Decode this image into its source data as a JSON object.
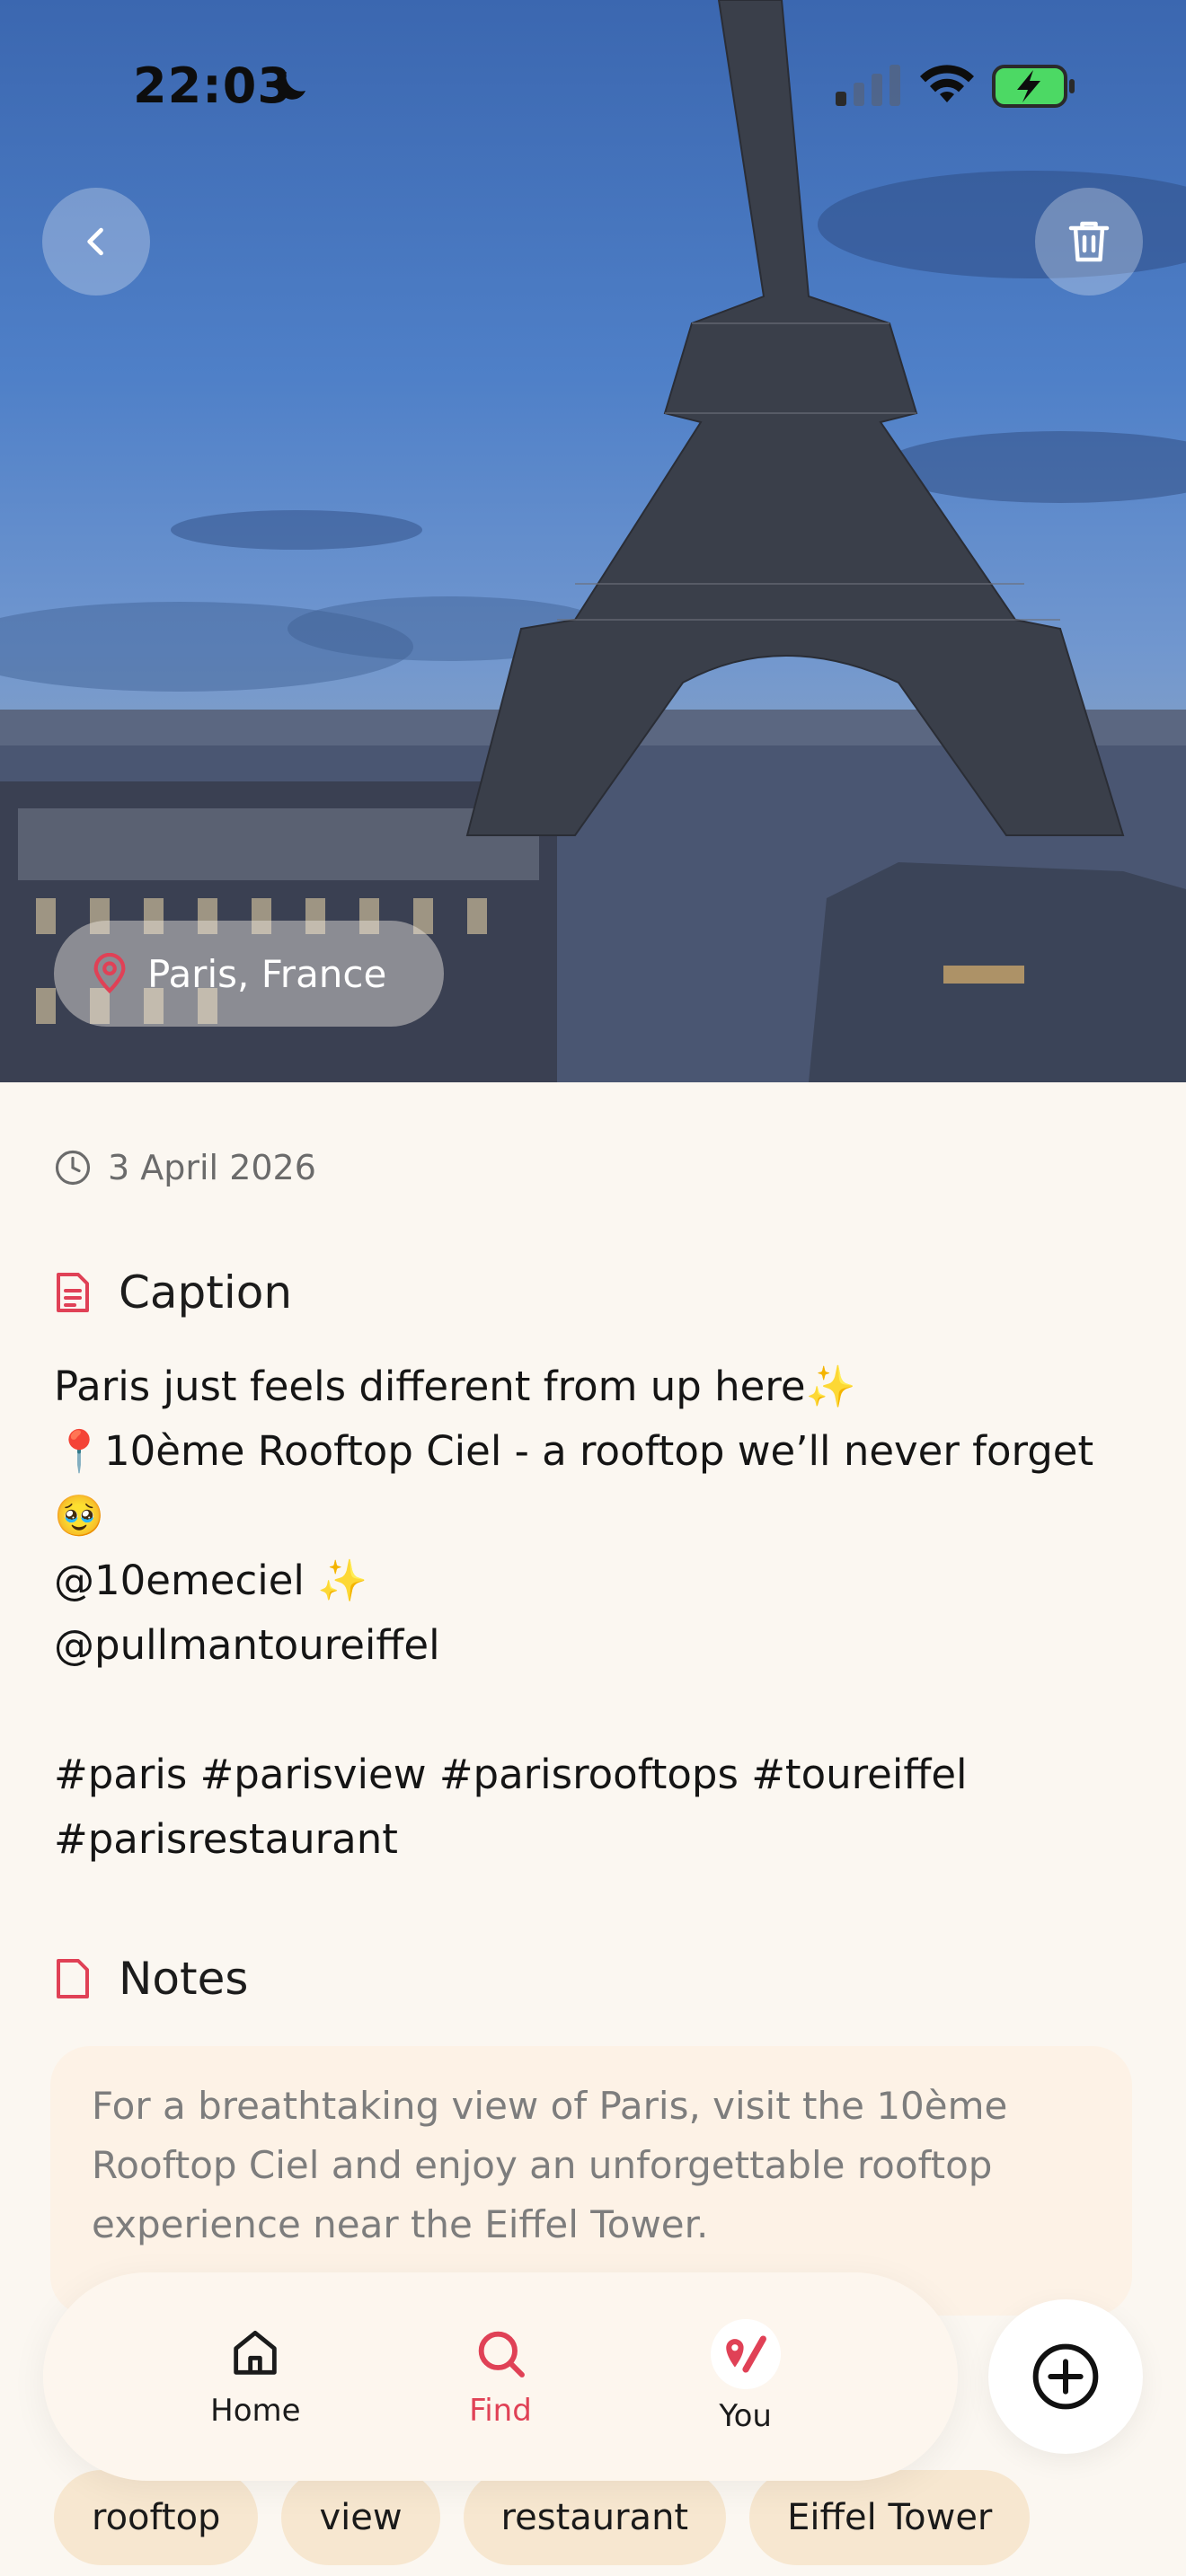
{
  "status_bar": {
    "time": "22:03"
  },
  "hero": {
    "location": "Paris, France"
  },
  "post": {
    "date": "3 April 2026",
    "caption_title": "Caption",
    "caption_lines": [
      "Paris just feels different from up here✨",
      "📍10ème Rooftop Ciel - a rooftop we’ll never forget",
      "🥹",
      "@10emeciel ✨",
      "@pullmantoureiffel",
      "",
      "#paris #parisview #parisrooftops #toureiffel",
      "#parisrestaurant"
    ],
    "notes_title": "Notes",
    "notes_text": "For a breathtaking view of Paris, visit the 10ème Rooftop Ciel and enjoy an unforgettable rooftop experience near the Eiffel Tower.",
    "tags": [
      "rooftop",
      "view",
      "restaurant",
      "Eiffel Tower"
    ]
  },
  "tabbar": {
    "home_label": "Home",
    "find_label": "Find",
    "you_label": "You"
  },
  "colors": {
    "accent": "#e04156",
    "background": "#fbf7f1",
    "tag_bg": "#f7e7d0",
    "notes_bg": "#fdf2e6"
  }
}
